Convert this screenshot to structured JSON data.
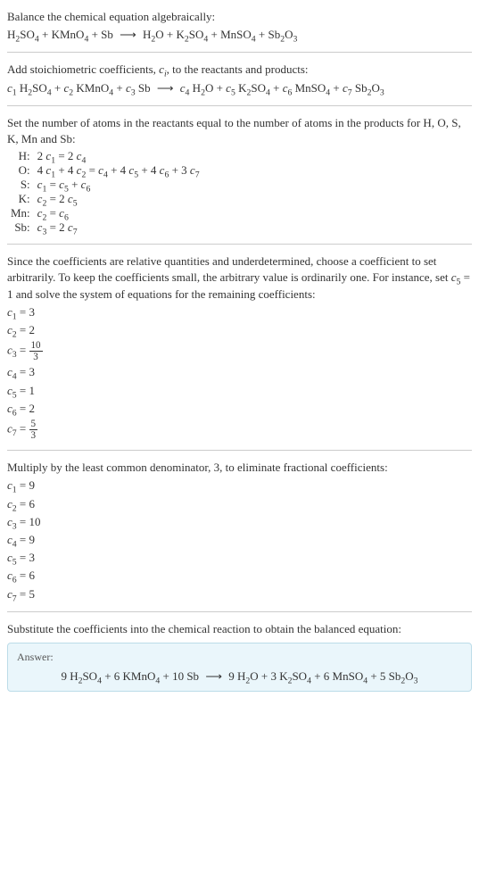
{
  "intro": {
    "line1": "Balance the chemical equation algebraically:",
    "eq_plain": "H₂SO₄ + KMnO₄ + Sb ⟶ H₂O + K₂SO₄ + MnSO₄ + Sb₂O₃"
  },
  "step2": {
    "text": "Add stoichiometric coefficients, c_i, to the reactants and products:",
    "eq": "c₁ H₂SO₄ + c₂ KMnO₄ + c₃ Sb ⟶ c₄ H₂O + c₅ K₂SO₄ + c₆ MnSO₄ + c₇ Sb₂O₃"
  },
  "step3": {
    "text": "Set the number of atoms in the reactants equal to the number of atoms in the products for H, O, S, K, Mn and Sb:",
    "rows": [
      {
        "el": "H:",
        "eq": "2 c₁ = 2 c₄"
      },
      {
        "el": "O:",
        "eq": "4 c₁ + 4 c₂ = c₄ + 4 c₅ + 4 c₆ + 3 c₇"
      },
      {
        "el": "S:",
        "eq": "c₁ = c₅ + c₆"
      },
      {
        "el": "K:",
        "eq": "c₂ = 2 c₅"
      },
      {
        "el": "Mn:",
        "eq": "c₂ = c₆"
      },
      {
        "el": "Sb:",
        "eq": "c₃ = 2 c₇"
      }
    ]
  },
  "step4": {
    "text": "Since the coefficients are relative quantities and underdetermined, choose a coefficient to set arbitrarily. To keep the coefficients small, the arbitrary value is ordinarily one. For instance, set c₅ = 1 and solve the system of equations for the remaining coefficients:",
    "vals": {
      "c1": "c₁ = 3",
      "c2": "c₂ = 2",
      "c3_lhs": "c₃ = ",
      "c3_num": "10",
      "c3_den": "3",
      "c4": "c₄ = 3",
      "c5": "c₅ = 1",
      "c6": "c₆ = 2",
      "c7_lhs": "c₇ = ",
      "c7_num": "5",
      "c7_den": "3"
    }
  },
  "step5": {
    "text": "Multiply by the least common denominator, 3, to eliminate fractional coefficients:",
    "vals": [
      "c₁ = 9",
      "c₂ = 6",
      "c₃ = 10",
      "c₄ = 9",
      "c₅ = 3",
      "c₆ = 6",
      "c₇ = 5"
    ]
  },
  "step6": {
    "text": "Substitute the coefficients into the chemical reaction to obtain the balanced equation:"
  },
  "answer": {
    "label": "Answer:",
    "eq": "9 H₂SO₄ + 6 KMnO₄ + 10 Sb ⟶ 9 H₂O + 3 K₂SO₄ + 6 MnSO₄ + 5 Sb₂O₃"
  },
  "chart_data": {
    "type": "table",
    "title": "Balanced reaction stoichiometric coefficients",
    "species": [
      "H₂SO₄",
      "KMnO₄",
      "Sb",
      "H₂O",
      "K₂SO₄",
      "MnSO₄",
      "Sb₂O₃"
    ],
    "coefficients": [
      9,
      6,
      10,
      9,
      3,
      6,
      5
    ],
    "element_balance": {
      "H": "2 c₁ = 2 c₄",
      "O": "4 c₁ + 4 c₂ = c₄ + 4 c₅ + 4 c₆ + 3 c₇",
      "S": "c₁ = c₅ + c₆",
      "K": "c₂ = 2 c₅",
      "Mn": "c₂ = c₆",
      "Sb": "c₃ = 2 c₇"
    }
  }
}
